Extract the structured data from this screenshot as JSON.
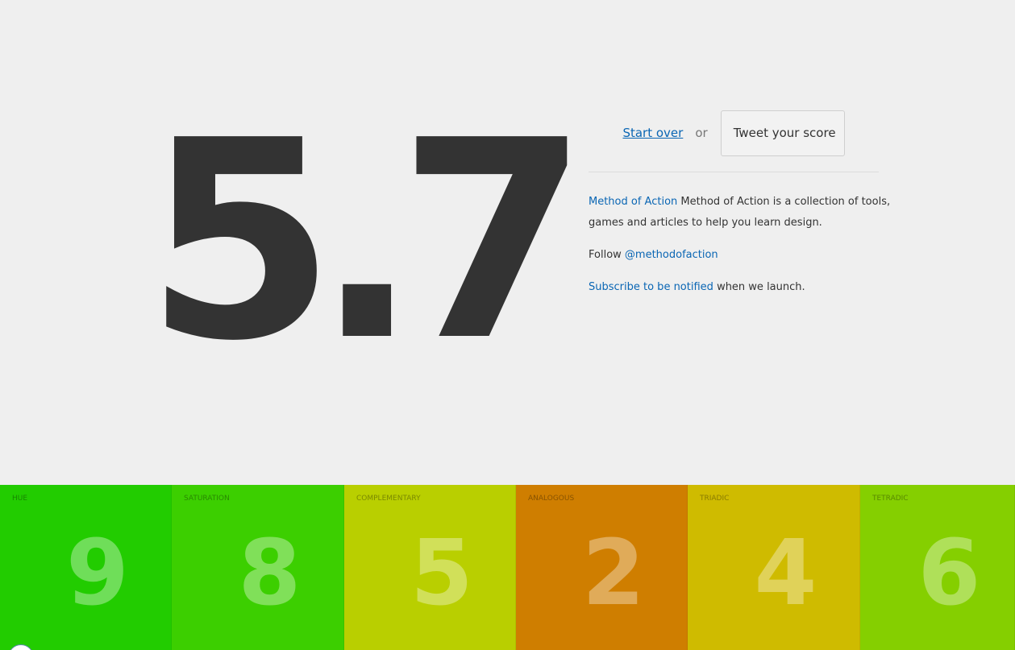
{
  "score": "5.7",
  "actions": {
    "start_over": "Start over",
    "or": "or",
    "tweet": "Tweet your score"
  },
  "info": {
    "brand_link": "Method of Action",
    "description": "Method of Action is a collection of tools, games and articles to help you learn design.",
    "follow_prefix": "Follow",
    "twitter_handle": "@methodofaction",
    "subscribe_link": "Subscribe to be notified",
    "subscribe_suffix": "when we launch."
  },
  "results": [
    {
      "label": "HUE",
      "value": "9",
      "color": "#22cc00"
    },
    {
      "label": "SATURATION",
      "value": "8",
      "color": "#3ccf00"
    },
    {
      "label": "COMPLEMENTARY",
      "value": "5",
      "color": "#b9cf00"
    },
    {
      "label": "ANALOGOUS",
      "value": "2",
      "color": "#cf7e00"
    },
    {
      "label": "TRIADIC",
      "value": "4",
      "color": "#cfbb00"
    },
    {
      "label": "TETRADIC",
      "value": "6",
      "color": "#85cf00"
    }
  ]
}
